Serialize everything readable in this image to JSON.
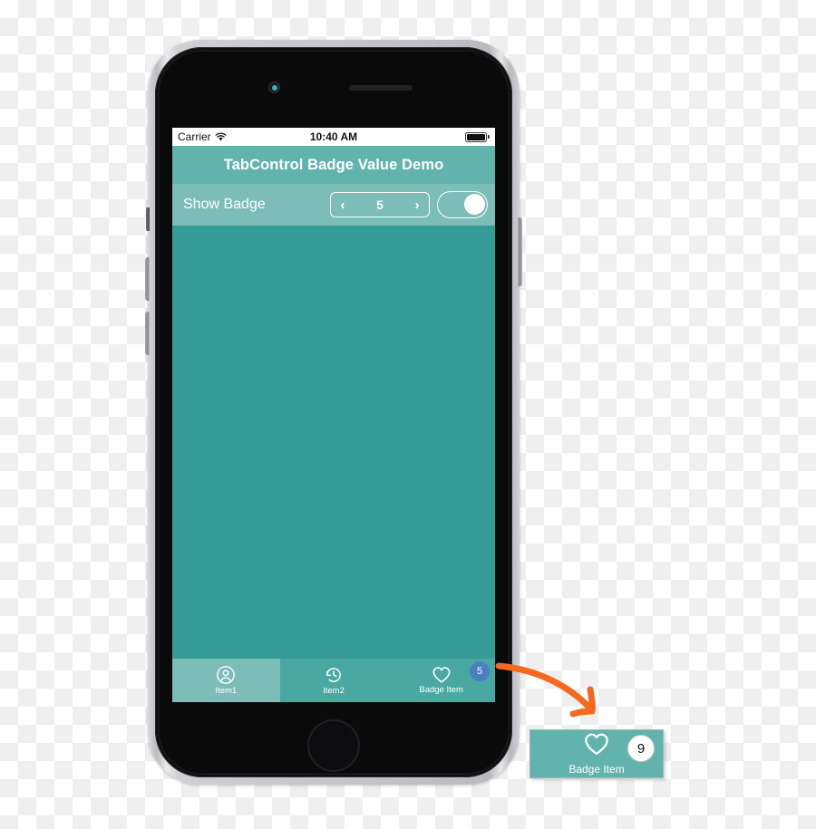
{
  "device": {
    "name": "iphone-mockup",
    "chrome": {
      "earpiece": "earpiece-speaker",
      "camera": "front-camera",
      "home": "home-button",
      "silent_switch": "silent-switch",
      "volume_up": "volume-up-button",
      "volume_down": "volume-down-button",
      "power": "power-button"
    }
  },
  "status_bar": {
    "carrier": "Carrier",
    "wifi_icon": "wifi-icon",
    "time": "10:40 AM",
    "battery_icon": "battery-full-icon"
  },
  "nav_bar": {
    "title": "TabControl Badge Value Demo"
  },
  "settings_row": {
    "label": "Show Badge",
    "stepper": {
      "decrement_label": "‹",
      "value": "5",
      "increment_label": "›",
      "decrement_icon": "chevron-left-icon",
      "increment_icon": "chevron-right-icon"
    },
    "toggle": {
      "state": "on",
      "icon": "switch-toggle-icon"
    }
  },
  "tab_bar": {
    "tabs": [
      {
        "label": "Item1",
        "icon": "person-circle-icon",
        "selected": true,
        "badge": ""
      },
      {
        "label": "Item2",
        "icon": "history-clock-icon",
        "selected": false,
        "badge": ""
      },
      {
        "label": "Badge Item",
        "icon": "heart-outline-icon",
        "selected": false,
        "badge": "5"
      }
    ]
  },
  "callout": {
    "label": "Badge Item",
    "icon": "heart-outline-icon",
    "badge": "9",
    "arrow_icon": "curved-arrow-icon"
  },
  "colors": {
    "nav_bar": "#62b3ad",
    "settings_row": "#7cbdb7",
    "content": "#359b96",
    "tab_bar": "#4aa8a2",
    "tab_selected": "#7cbdb7",
    "tab_badge": "#4a7fc1",
    "callout_badge_bg": "#ffffff",
    "arrow": "#f4691d",
    "device_body": "#0a0a0a",
    "device_frame": "#cfd1d5"
  }
}
